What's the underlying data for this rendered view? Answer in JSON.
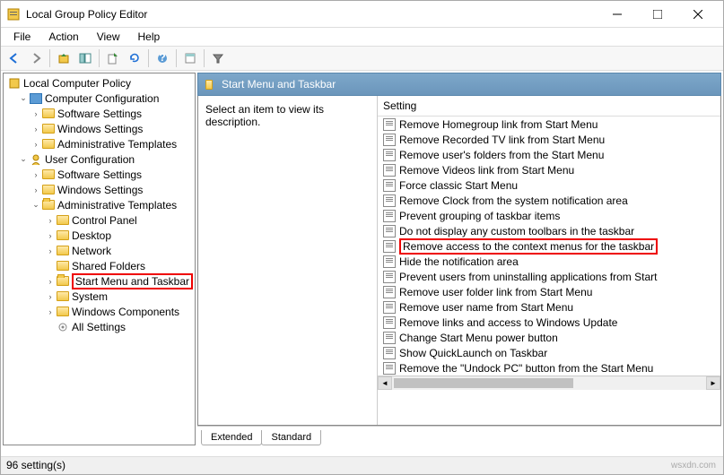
{
  "window": {
    "title": "Local Group Policy Editor"
  },
  "menu": {
    "file": "File",
    "action": "Action",
    "view": "View",
    "help": "Help"
  },
  "tree": {
    "root": "Local Computer Policy",
    "comp_config": "Computer Configuration",
    "cc_software": "Software Settings",
    "cc_windows": "Windows Settings",
    "cc_admin": "Administrative Templates",
    "user_config": "User Configuration",
    "uc_software": "Software Settings",
    "uc_windows": "Windows Settings",
    "uc_admin": "Administrative Templates",
    "at_control": "Control Panel",
    "at_desktop": "Desktop",
    "at_network": "Network",
    "at_shared": "Shared Folders",
    "at_startmenu": "Start Menu and Taskbar",
    "at_system": "System",
    "at_wincomp": "Windows Components",
    "at_allset": "All Settings"
  },
  "right": {
    "header": "Start Menu and Taskbar",
    "desc": "Select an item to view its description.",
    "col_setting": "Setting"
  },
  "settings": [
    "Remove Homegroup link from Start Menu",
    "Remove Recorded TV link from Start Menu",
    "Remove user's folders from the Start Menu",
    "Remove Videos link from Start Menu",
    "Force classic Start Menu",
    "Remove Clock from the system notification area",
    "Prevent grouping of taskbar items",
    "Do not display any custom toolbars in the taskbar",
    "Remove access to the context menus for the taskbar",
    "Hide the notification area",
    "Prevent users from uninstalling applications from Start",
    "Remove user folder link from Start Menu",
    "Remove user name from Start Menu",
    "Remove links and access to Windows Update",
    "Change Start Menu power button",
    "Show QuickLaunch on Taskbar",
    "Remove the \"Undock PC\" button from the Start Menu"
  ],
  "highlighted_setting_index": 8,
  "tabs": {
    "extended": "Extended",
    "standard": "Standard"
  },
  "status": "96 setting(s)",
  "watermark": "wsxdn.com"
}
